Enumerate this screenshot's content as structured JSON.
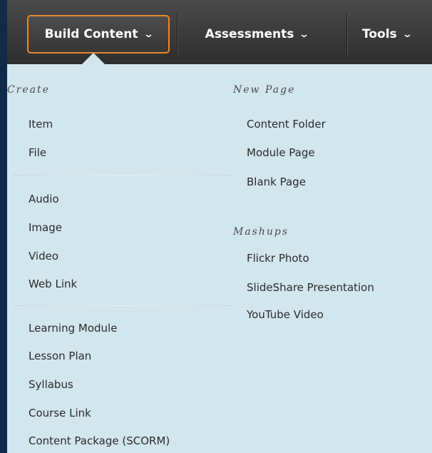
{
  "toolbar": {
    "build_content": "Build Content",
    "assessments": "Assessments",
    "tools": "Tools",
    "chevron": "⌄"
  },
  "menu": {
    "create": {
      "heading": "Create",
      "group1": [
        "Item",
        "File"
      ],
      "group2": [
        "Audio",
        "Image",
        "Video",
        "Web Link"
      ],
      "group3": [
        "Learning Module",
        "Lesson Plan",
        "Syllabus",
        "Course Link",
        "Content Package (SCORM)"
      ]
    },
    "new_page": {
      "heading": "New Page",
      "items": [
        "Content Folder",
        "Module Page",
        "Blank Page"
      ]
    },
    "mashups": {
      "heading": "Mashups",
      "items": [
        "Flickr Photo",
        "SlideShare Presentation",
        "YouTube Video"
      ]
    }
  },
  "colors": {
    "accent_border": "#e8892b",
    "toolbar_bg": "#3a3a3a",
    "menu_bg": "#d2e6ee"
  }
}
